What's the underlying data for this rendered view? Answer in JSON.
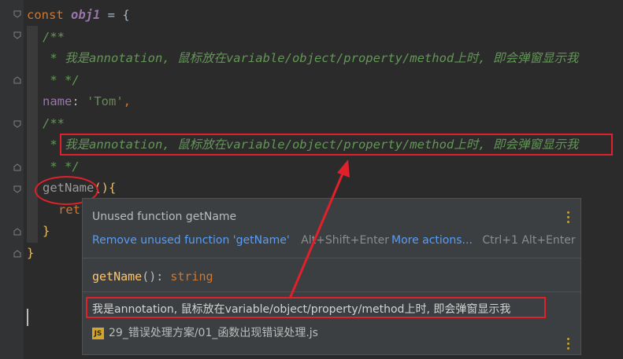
{
  "editor": {
    "code": {
      "line1_kw": "const",
      "line1_var": "obj1",
      "line1_rest": " = {",
      "doc_open": "/**",
      "doc_text": " * 我是annotation, 鼠标放在variable/object/property/method上时, 即会弹窗显示我",
      "doc_close": " * */",
      "name_key": "name",
      "name_colon": ": ",
      "name_value": "'Tom'",
      "name_comma": ",",
      "doc_text2": "我是annotation, 鼠标放在variable/object/property/method上时, 即会弹窗显示我",
      "doc_prefix2": " * ",
      "fn_name": "getName",
      "fn_rest": "(){",
      "ret_partial": "ret",
      "inner_close": "}",
      "outer_close": "}"
    }
  },
  "popup": {
    "warning": "Unused function getName",
    "fix_link": "Remove unused function 'getName'",
    "fix_shortcut": "Alt+Shift+Enter",
    "more_link": "More actions...",
    "more_shortcut": "Ctrl+1 Alt+Enter",
    "sig_name": "getName",
    "sig_rest": "(): ",
    "sig_type": "string",
    "doc": "我是annotation, 鼠标放在variable/object/property/method上时, 即会弹窗显示我",
    "file_icon": "JS",
    "file_path": "29_错误处理方案/01_函数出现错误处理.js"
  },
  "colors": {
    "accent_annotation": "#e0202a",
    "link": "#589df6"
  }
}
